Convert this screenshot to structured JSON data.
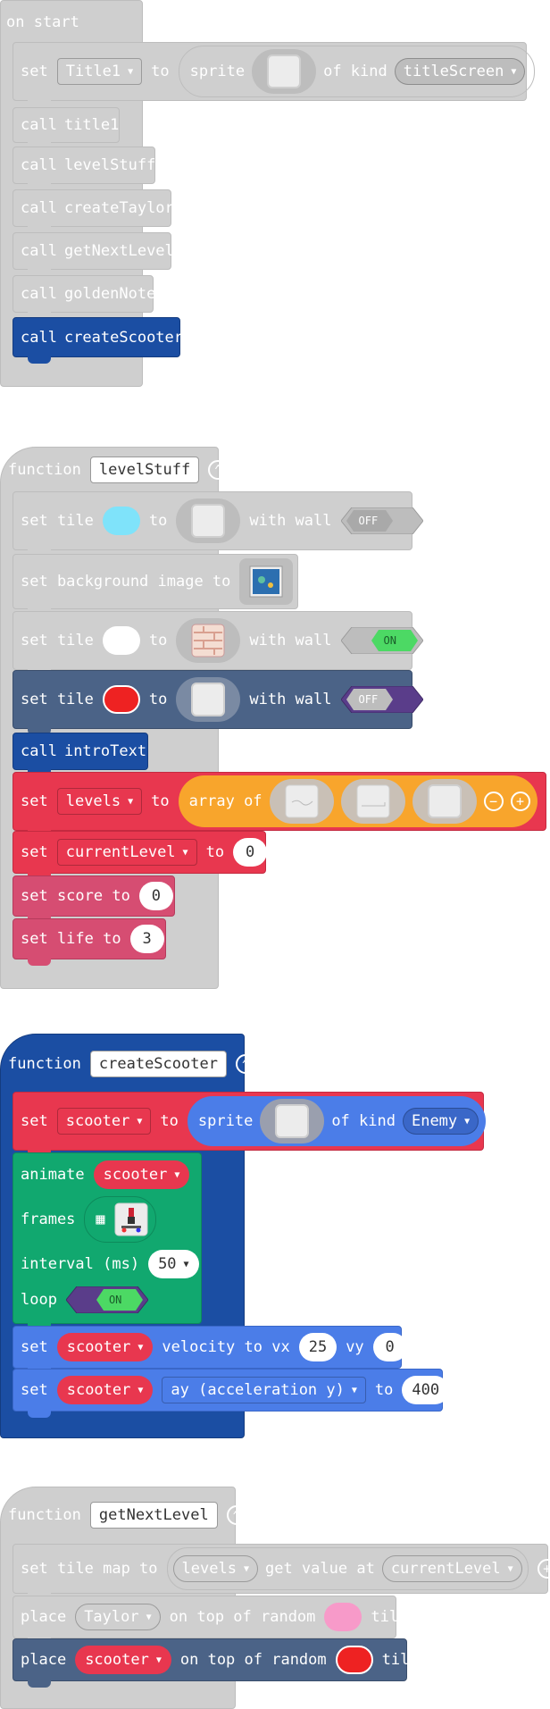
{
  "on_start": {
    "label": "on start",
    "set_title": {
      "set": "set",
      "var": "Title1",
      "to": "to",
      "sprite": "sprite",
      "of_kind": "of kind",
      "kind": "titleScreen"
    },
    "calls": [
      {
        "call": "call",
        "name": "title1"
      },
      {
        "call": "call",
        "name": "levelStuff"
      },
      {
        "call": "call",
        "name": "createTaylor"
      },
      {
        "call": "call",
        "name": "getNextLevel"
      },
      {
        "call": "call",
        "name": "goldenNote"
      },
      {
        "call": "call",
        "name": "createScooter"
      }
    ]
  },
  "fn_levelStuff": {
    "function": "function",
    "name": "levelStuff",
    "tile1": {
      "set_tile": "set tile",
      "to": "to",
      "with_wall": "with wall",
      "wall": "OFF"
    },
    "bg": {
      "label": "set background image to"
    },
    "tile2": {
      "set_tile": "set tile",
      "to": "to",
      "with_wall": "with wall",
      "wall": "ON"
    },
    "tile3": {
      "set_tile": "set tile",
      "to": "to",
      "with_wall": "with wall",
      "wall": "OFF"
    },
    "intro": {
      "call": "call",
      "name": "introText"
    },
    "levels": {
      "set": "set",
      "var": "levels",
      "to": "to",
      "array_of": "array of"
    },
    "current": {
      "set": "set",
      "var": "currentLevel",
      "to": "to",
      "value": "0"
    },
    "score": {
      "label": "set score to",
      "value": "0"
    },
    "life": {
      "label": "set life to",
      "value": "3"
    }
  },
  "fn_createScooter": {
    "function": "function",
    "name": "createScooter",
    "set_sprite": {
      "set": "set",
      "var": "scooter",
      "to": "to",
      "sprite": "sprite",
      "of_kind": "of kind",
      "kind": "Enemy"
    },
    "animate": {
      "animate": "animate",
      "var": "scooter",
      "frames": "frames",
      "interval": "interval (ms)",
      "interval_value": "50",
      "loop": "loop",
      "loop_value": "ON"
    },
    "velocity": {
      "set": "set",
      "var": "scooter",
      "label": "velocity to vx",
      "vx": "25",
      "vy_label": "vy",
      "vy": "0"
    },
    "accel": {
      "set": "set",
      "var": "scooter",
      "prop": "ay (acceleration y)",
      "to": "to",
      "value": "400"
    }
  },
  "fn_getNextLevel": {
    "function": "function",
    "name": "getNextLevel",
    "tilemap": {
      "label": "set tile map to",
      "list": "levels",
      "get_value_at": "get value at",
      "index": "currentLevel"
    },
    "place1": {
      "place": "place",
      "var": "Taylor",
      "on_top": "on top of random",
      "tile": "tile"
    },
    "place2": {
      "place": "place",
      "var": "scooter",
      "on_top": "on top of random",
      "tile": "tile"
    }
  },
  "colors": {
    "disabled": "#cfcfcf",
    "disabled_border": "#bdbdbd",
    "function_blue": "#1b4ea3",
    "scene_slate": "#4b6387",
    "variables_red": "#e8374f",
    "info_pink": "#d64d72",
    "array_orange": "#f8a52c",
    "sprites_blue": "#4b7de8",
    "animation_green": "#11a86f"
  }
}
